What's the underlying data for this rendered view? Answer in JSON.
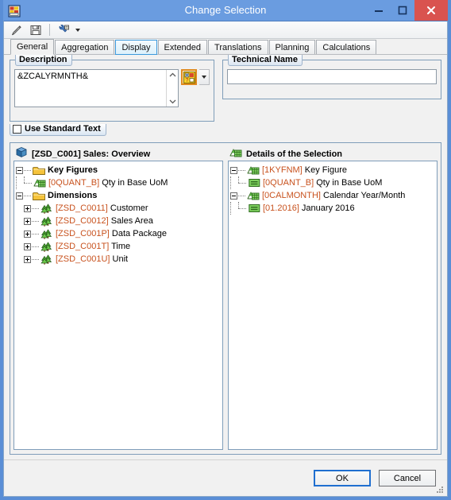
{
  "window": {
    "title": "Change Selection",
    "app_icon": "sap-query-designer-icon",
    "controls": {
      "minimize": "minimize-icon",
      "maximize": "maximize-icon",
      "close": "close-icon"
    }
  },
  "toolbar": {
    "buttons": [
      {
        "name": "check-pencil-icon",
        "tooltip": "Check"
      },
      {
        "name": "save-icon",
        "tooltip": "Save"
      },
      {
        "name": "properties-wrench-icon",
        "tooltip": "Properties"
      }
    ]
  },
  "tabs": [
    {
      "label": "General",
      "state": "active"
    },
    {
      "label": "Aggregation",
      "state": "normal"
    },
    {
      "label": "Display",
      "state": "hover"
    },
    {
      "label": "Extended",
      "state": "normal"
    },
    {
      "label": "Translations",
      "state": "normal"
    },
    {
      "label": "Planning",
      "state": "normal"
    },
    {
      "label": "Calculations",
      "state": "normal"
    }
  ],
  "description": {
    "group_label": "Description",
    "value": "&ZCALYRMNTH&",
    "placeholder": "",
    "scroll_up": "scroll-up-arrow-icon",
    "scroll_down": "scroll-down-arrow-icon",
    "fx_button": "text-variable-icon",
    "fx_dropdown": "chevron-down-icon"
  },
  "technical_name": {
    "group_label": "Technical Name",
    "value": "",
    "placeholder": ""
  },
  "standard_text": {
    "label": "Use Standard Text",
    "checked": false
  },
  "left_panel": {
    "icon": "infoprovider-cube-icon",
    "title_technical": "[ZSD_C001]",
    "title_text": " Sales: Overview",
    "tree": [
      {
        "level": 0,
        "expander": "minus",
        "icon": "folder-icon",
        "technical": "",
        "label": "Key Figures",
        "bold": true,
        "last": false
      },
      {
        "level": 1,
        "expander": "none",
        "icon": "key-figure-icon",
        "technical": "[0QUANT_B]",
        "label": " Qty in Base UoM",
        "bold": false,
        "last": true
      },
      {
        "level": 0,
        "expander": "minus",
        "icon": "folder-icon",
        "technical": "",
        "label": "Dimensions",
        "bold": true,
        "last": true
      },
      {
        "level": 1,
        "expander": "plus",
        "icon": "dimension-trees-icon",
        "technical": "[ZSD_C0011]",
        "label": " Customer",
        "bold": false,
        "last": false
      },
      {
        "level": 1,
        "expander": "plus",
        "icon": "dimension-trees-icon",
        "technical": "[ZSD_C0012]",
        "label": " Sales Area",
        "bold": false,
        "last": false
      },
      {
        "level": 1,
        "expander": "plus",
        "icon": "dimension-trees-icon",
        "technical": "[ZSD_C001P]",
        "label": " Data Package",
        "bold": false,
        "last": false
      },
      {
        "level": 1,
        "expander": "plus",
        "icon": "dimension-trees-icon",
        "technical": "[ZSD_C001T]",
        "label": " Time",
        "bold": false,
        "last": false
      },
      {
        "level": 1,
        "expander": "plus",
        "icon": "dimension-trees-icon",
        "technical": "[ZSD_C001U]",
        "label": " Unit",
        "bold": false,
        "last": true
      }
    ]
  },
  "right_panel": {
    "icon": "key-figure-icon",
    "title_text": "Details of the Selection",
    "tree": [
      {
        "level": 0,
        "expander": "minus",
        "icon": "key-figure-icon",
        "technical": "[1KYFNM]",
        "label": " Key Figure",
        "last": false
      },
      {
        "level": 1,
        "expander": "none",
        "icon": "member-green-icon",
        "technical": "[0QUANT_B]",
        "label": " Qty in Base UoM",
        "last": true
      },
      {
        "level": 0,
        "expander": "minus",
        "icon": "key-figure-icon",
        "technical": "[0CALMONTH]",
        "label": " Calendar Year/Month",
        "last": true
      },
      {
        "level": 1,
        "expander": "none",
        "icon": "member-green-icon",
        "technical": "[01.2016]",
        "label": " January 2016",
        "last": true
      }
    ]
  },
  "buttons": {
    "ok": "OK",
    "cancel": "Cancel"
  },
  "colors": {
    "title_bar": "#6a9ce0",
    "close_button": "#d9534f",
    "technical_text": "#c8521e",
    "accent_border": "#7f9db9",
    "fx_highlight": "#e08a1e",
    "tab_hover": "#3c99dc",
    "default_button_border": "#1f6fd0"
  }
}
